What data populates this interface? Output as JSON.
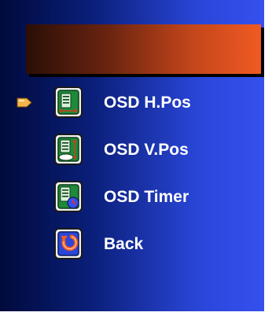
{
  "colors": {
    "panel_gradient": [
      "#000a3c",
      "#0a1f7a",
      "#2a46d8",
      "#3550ee"
    ],
    "title_bar_gradient": [
      "#2a0e06",
      "#c2451a",
      "#f05a22"
    ],
    "label": "#ffffff",
    "cursor": "#f2b64a"
  },
  "title_bar": {
    "text": ""
  },
  "menu": {
    "selected_index": 0,
    "items": [
      {
        "label": "OSD H.Pos",
        "icon": "osd-horizontal-position-icon"
      },
      {
        "label": "OSD V.Pos",
        "icon": "osd-vertical-position-icon"
      },
      {
        "label": "OSD Timer",
        "icon": "osd-timer-icon"
      },
      {
        "label": "Back",
        "icon": "back-return-icon"
      }
    ]
  }
}
